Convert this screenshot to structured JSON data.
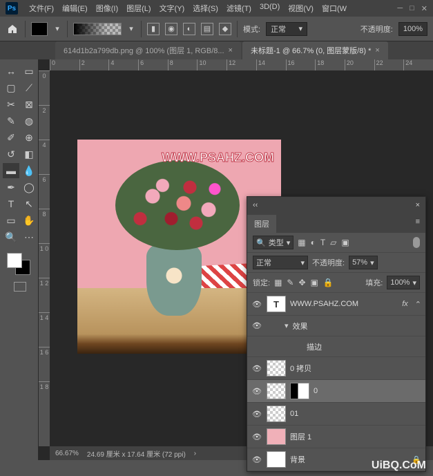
{
  "menu": {
    "file": "文件(F)",
    "edit": "编辑(E)",
    "image": "图像(I)",
    "layer": "图层(L)",
    "type": "文字(Y)",
    "select": "选择(S)",
    "filter": "滤镜(T)",
    "threed": "3D(D)",
    "view": "视图(V)",
    "window": "窗口(W"
  },
  "optbar": {
    "mode_label": "模式:",
    "mode_value": "正常",
    "opacity_label": "不透明度:",
    "opacity_value": "100%"
  },
  "tabs": {
    "inactive": {
      "title": "614d1b2a799db.png @ 100% (图层 1, RGB/8..."
    },
    "active": {
      "title": "未标题-1 @ 66.7% (0, 图层蒙版/8) *"
    }
  },
  "rulers": {
    "h": [
      "0",
      "2",
      "4",
      "6",
      "8",
      "10",
      "12",
      "14",
      "16",
      "18",
      "20",
      "22",
      "24"
    ],
    "v": [
      "0",
      "2",
      "4",
      "6",
      "8",
      "1 0",
      "1 2",
      "1 4",
      "1 6",
      "1 8"
    ]
  },
  "canvas": {
    "watermark": "WWW.PSAHZ.COM"
  },
  "status": {
    "zoom": "66.67%",
    "docsize": "24.69 厘米 x 17.64 厘米 (72 ppi)"
  },
  "layers_panel": {
    "title": "图层",
    "filter_label": "类型",
    "blend": "正常",
    "opacity_label": "不透明度:",
    "opacity_value": "57%",
    "lock_label": "锁定:",
    "fill_label": "填充:",
    "fill_value": "100%",
    "items": [
      {
        "name": "WWW.PSAHZ.COM",
        "type": "T",
        "fx": true
      },
      {
        "name": "效果",
        "sub": true
      },
      {
        "name": "描边",
        "sub": true,
        "deep": true
      },
      {
        "name": "0 拷贝",
        "thumb": "img"
      },
      {
        "name": "0",
        "thumb": "img",
        "mask": true,
        "selected": true
      },
      {
        "name": "01",
        "thumb": "img2"
      },
      {
        "name": "图层 1",
        "thumb": "pink"
      },
      {
        "name": "背景",
        "thumb": "white",
        "locked": true
      }
    ]
  },
  "footer_wm": "UiBQ.CoM"
}
